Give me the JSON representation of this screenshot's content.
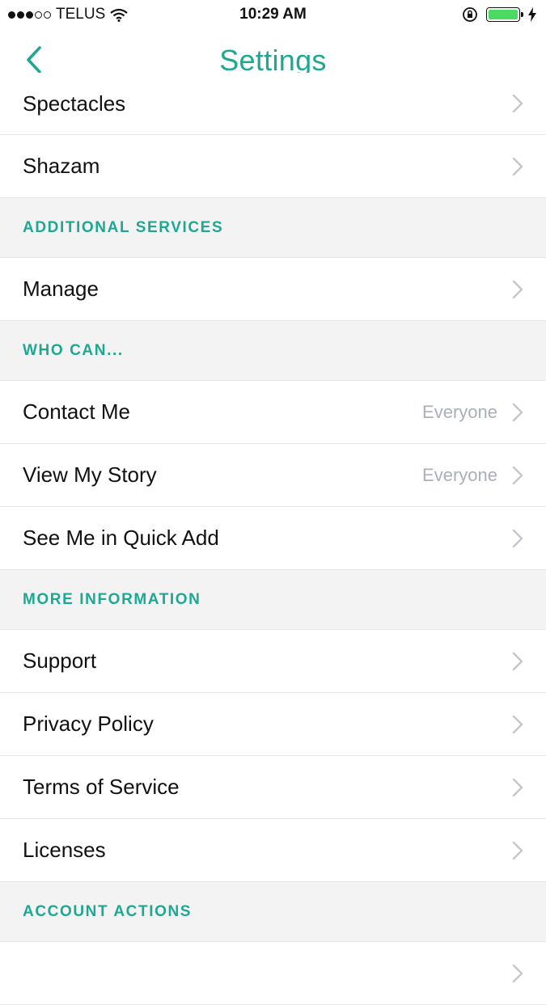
{
  "status_bar": {
    "carrier": "TELUS",
    "time": "10:29 AM",
    "signal_strength": 3,
    "battery_level": 1.0,
    "icons": [
      "wifi-icon",
      "orientation-lock-icon",
      "battery-icon",
      "charging-bolt-icon"
    ]
  },
  "nav": {
    "title": "Settings",
    "back_icon": "back-chevron-icon"
  },
  "rows": [
    {
      "type": "row",
      "label": "Spectacles",
      "value": ""
    },
    {
      "type": "row",
      "label": "Shazam",
      "value": ""
    },
    {
      "type": "section",
      "label": "ADDITIONAL SERVICES"
    },
    {
      "type": "row",
      "label": "Manage",
      "value": ""
    },
    {
      "type": "section",
      "label": "WHO CAN..."
    },
    {
      "type": "row",
      "label": "Contact Me",
      "value": "Everyone"
    },
    {
      "type": "row",
      "label": "View My Story",
      "value": "Everyone"
    },
    {
      "type": "row",
      "label": "See Me in Quick Add",
      "value": ""
    },
    {
      "type": "section",
      "label": "MORE INFORMATION"
    },
    {
      "type": "row",
      "label": "Support",
      "value": ""
    },
    {
      "type": "row",
      "label": "Privacy Policy",
      "value": ""
    },
    {
      "type": "row",
      "label": "Terms of Service",
      "value": ""
    },
    {
      "type": "row",
      "label": "Licenses",
      "value": ""
    },
    {
      "type": "section",
      "label": "ACCOUNT ACTIONS"
    },
    {
      "type": "row",
      "label": "",
      "value": ""
    }
  ],
  "colors": {
    "accent": "#1ea891",
    "section_bg": "#f3f3f3",
    "value_text": "#aab0b8",
    "chevron": "#c4c7cc",
    "battery": "#4cd964"
  }
}
